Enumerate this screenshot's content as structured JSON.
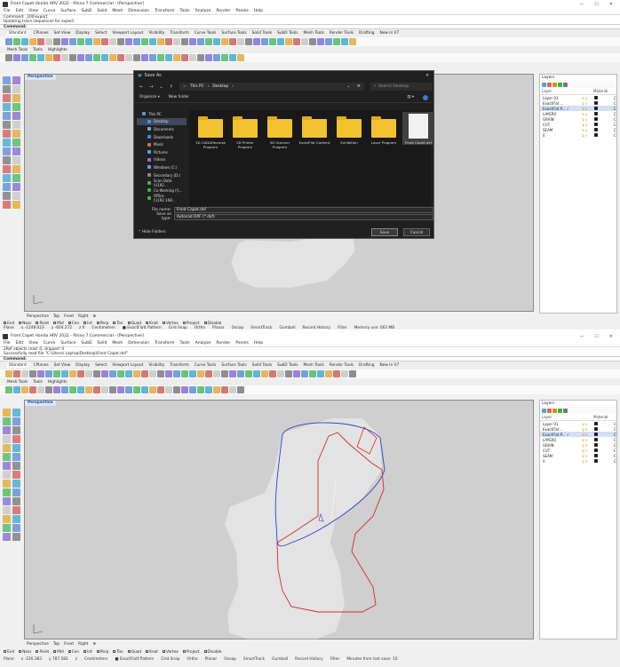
{
  "colors": {
    "viewport_bg": "#cfcfcf",
    "shape_fill": "#e3e3e3",
    "curve_red": "#d42a2a",
    "curve_blue": "#2d3fd0",
    "dialog_bg": "#202020",
    "folder": "#f2c230"
  },
  "window1": {
    "title": "Front Capet Honda HRV 2022 - Rhino 7 Commercial - [Perspective]",
    "menu": [
      "File",
      "Edit",
      "View",
      "Curve",
      "Surface",
      "SubD",
      "Solid",
      "Mesh",
      "Dimension",
      "Transform",
      "Tools",
      "Analyze",
      "Render",
      "Panels",
      "Help"
    ],
    "history": [
      "Command: _DXFexport",
      "Updating trace sequences for export."
    ],
    "command_prompt": "Command:",
    "toolbar_tabs": [
      "Standard",
      "CPlanes",
      "Set View",
      "Display",
      "Select",
      "Viewport Layout",
      "Visibility",
      "Transform",
      "Curve Tools",
      "Surface Tools",
      "Solid Tools",
      "SubD Tools",
      "Mesh Tools",
      "Render Tools",
      "Drafting",
      "New in V7"
    ],
    "sub_tabs": [
      "Mesh Tools",
      "Tools",
      "Highlights"
    ],
    "viewport_label": "Perspective",
    "view_tabs": [
      "Perspective",
      "Top",
      "Front",
      "Right",
      "⊕"
    ],
    "snaps": [
      "End",
      "Near",
      "Point",
      "Mid",
      "Cen",
      "Int",
      "Perp",
      "Tan",
      "Quad",
      "Knot",
      "Vertex",
      "Project",
      "Disable"
    ],
    "status": [
      "Plane",
      "x -1248.023",
      "y -604.272",
      "z 0",
      "Centimeters",
      "■ ExactFlatt Pattern",
      "Grid Snap",
      "Ortho",
      "Planar",
      "Osnap",
      "SmartTrack",
      "Gumball",
      "Record History",
      "Filter",
      "Memory use: 663 MB"
    ]
  },
  "layers": {
    "title": "Layers",
    "col_layer": "Layer",
    "col_material": "Material",
    "rows": [
      {
        "name": "Layer 01",
        "color": "#111111",
        "selected": false
      },
      {
        "name": "ExactFlat ...",
        "color": "#111111",
        "selected": false
      },
      {
        "name": "ExactFlat P... ✓",
        "color": "#111111",
        "selected": true
      },
      {
        "name": "LAYER0",
        "color": "#111111",
        "selected": false
      },
      {
        "name": "GRAIN",
        "color": "#111111",
        "selected": false
      },
      {
        "name": "CUT",
        "color": "#111111",
        "selected": false
      },
      {
        "name": "SEAM",
        "color": "#111111",
        "selected": false
      },
      {
        "name": "0",
        "color": "#111111",
        "selected": false
      }
    ],
    "mat_glyph": "C"
  },
  "dialog": {
    "title": "Save As",
    "close": "✕",
    "nav": [
      "←",
      "→",
      "⌄",
      "↑"
    ],
    "breadcrumb": [
      "This PC",
      "›",
      "Desktop",
      "›"
    ],
    "search_placeholder": "Search Desktop",
    "organize": "Organize ▾",
    "new_folder": "New folder",
    "sidebar": [
      {
        "label": "This PC",
        "color": "#5b9bd5"
      },
      {
        "label": "Desktop",
        "color": "#4a8fd6"
      },
      {
        "label": "Documents",
        "color": "#7aa6d8"
      },
      {
        "label": "Downloads",
        "color": "#3c8dde"
      },
      {
        "label": "Music",
        "color": "#e0625a"
      },
      {
        "label": "Pictures",
        "color": "#5aa0e0"
      },
      {
        "label": "Videos",
        "color": "#9a6ad6"
      },
      {
        "label": "Windows (C:)",
        "color": "#6a9fd8"
      },
      {
        "label": "Secondary (D:)",
        "color": "#888888"
      },
      {
        "label": "Scan Data (\\\\192...",
        "color": "#3ab04a"
      },
      {
        "label": "Co-Working (\\\\...",
        "color": "#3ab04a"
      },
      {
        "label": "Office (\\\\192.168...",
        "color": "#3ab04a"
      }
    ],
    "items": [
      {
        "label": "3D CAD&Reverse Program",
        "type": "folder"
      },
      {
        "label": "3D Printer Program",
        "type": "folder"
      },
      {
        "label": "3D Scanner Program",
        "type": "folder"
      },
      {
        "label": "ExactFlat Content",
        "type": "folder"
      },
      {
        "label": "Exhibition",
        "type": "folder"
      },
      {
        "label": "Laser Program",
        "type": "folder"
      },
      {
        "label": "Front Capet.dxf",
        "type": "file"
      }
    ],
    "file_name_label": "File name:",
    "file_name_value": "Front Capet.dxf",
    "save_type_label": "Save as type:",
    "save_type_value": "Autocad DXF (*.dxf)",
    "hide_folders": "⌃  Hide Folders",
    "save_button": "Save",
    "cancel_button": "Cancel"
  },
  "window2": {
    "title": "Front Capet Honda HRV 2022 - Rhino 7 Commercial - [Perspective]",
    "history": [
      "2Ref objects read: 0, skipped: 0",
      "Successfully read file \"C:\\Users\\ Laptop\\Desktop\\Front Capet.dxf\""
    ],
    "command_prompt": "Command:",
    "viewport_label": "Perspective",
    "status": [
      "Plane",
      "x -226.383",
      "y 787.582",
      "z",
      "Centimeters",
      "■ ExactFlatt Pattern",
      "Grid Snap",
      "Ortho",
      "Planar",
      "Osnap",
      "SmartTrack",
      "Gumball",
      "Record History",
      "Filter",
      "Minutes from last save: 10"
    ]
  }
}
